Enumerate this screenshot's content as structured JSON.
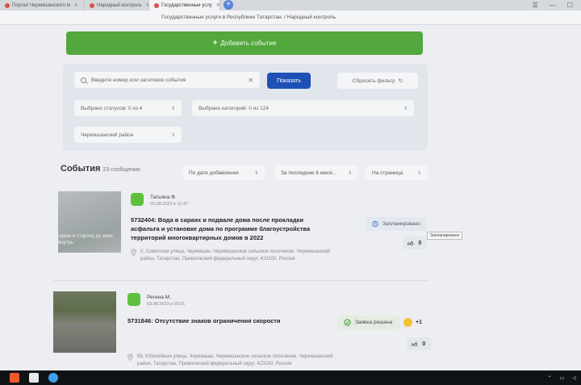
{
  "browser": {
    "tabs": [
      {
        "label": "Портал Черемшанского м"
      },
      {
        "label": "Народный контроль"
      },
      {
        "label": "Государственные услу"
      }
    ],
    "page_title": "Государственные услуги в Республике Татарстан. / Народный контроль"
  },
  "toolbar": {
    "add_event_label": "Добавить событие"
  },
  "filters": {
    "search_placeholder": "Введите номер или заголовок события",
    "show_label": "Показать",
    "reset_label": "Сбросить фильтр",
    "statuses_label": "Выбрано статусов: 0 из 4",
    "categories_label": "Выбрано категорий: 0 из 124",
    "district_label": "Черемшанский район"
  },
  "events": {
    "heading": "События",
    "count": "23 сообщения",
    "sort_by": "По дате добавления",
    "period": "За последние 6 меся...",
    "per_page": "На страница",
    "items": [
      {
        "author": "Татьяна Ф.",
        "date": "03.08.2023 в 11:47",
        "title": "5732404: Вода в сараях и подвале дома после прокладки асфальта и установке дома по программе благоустройства территорий многоквартирных домов в 2022",
        "address": "0, Советская улица, Черемшан, Черемшанское сельское поселение, Черемшанский район, Татарстан, Приволжский федеральный округ, 423100, Россия",
        "status": "Запланировано",
        "tooltip": "Запланировано",
        "likes": "0",
        "thumb_overlay": "сараи в сторону до жает внутрь"
      },
      {
        "author": "Регина М.",
        "date": "03.08.2023 в 09:31",
        "title": "5731846: Отсутствие знаков ограничения скорости",
        "address": "58, Юбилейная улица, Черемшан, Черемшанское сельское поселение, Черемшанский район, Татарстан, Приволжский федеральный округ, 423100, Россия",
        "status": "Заявка решена",
        "reaction": "+1",
        "likes": "0"
      }
    ]
  },
  "colors": {
    "add_button": "#52a73d",
    "show_button": "#1e50b6",
    "avatar": "#5fc03e"
  }
}
